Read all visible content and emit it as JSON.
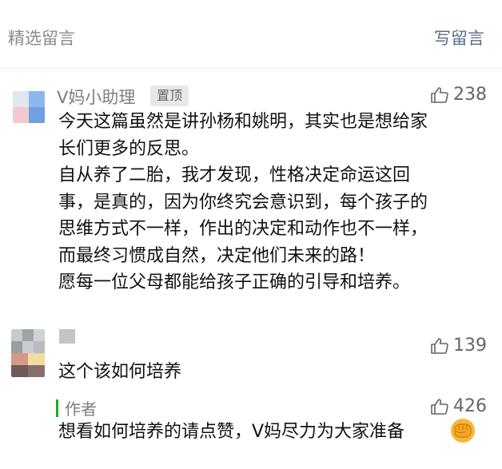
{
  "header": {
    "title": "精选留言",
    "write_label": "写留言"
  },
  "comments": [
    {
      "author": "V妈小助理",
      "badge": "置顶",
      "likes": "238",
      "lines": [
        "今天这篇虽然是讲孙杨和姚明，其实也是想给家",
        "长们更多的反思。",
        "自从养了二胎，我才发现，性格决定命运这回",
        "事，是真的，因为你终究会意识到，每个孩子的",
        "思维方式不一样，作出的决定和动作也不一样，",
        "而最终习惯成自然，决定他们未来的路！",
        "愿每一位父母都能给孩子正确的引导和培养。"
      ]
    },
    {
      "author": "",
      "likes": "139",
      "lines": [
        "这个该如何培养"
      ],
      "reply": {
        "author_label": "作者",
        "likes": "426",
        "text": "想看如何培养的请点赞，V妈尽力为大家准备",
        "emoji": "fist-emoji"
      }
    }
  ],
  "colors": {
    "link": "#5b6b8a",
    "secondary_text": "#7e7e7e",
    "author_bar": "#1aad19",
    "divider": "#ececec"
  }
}
